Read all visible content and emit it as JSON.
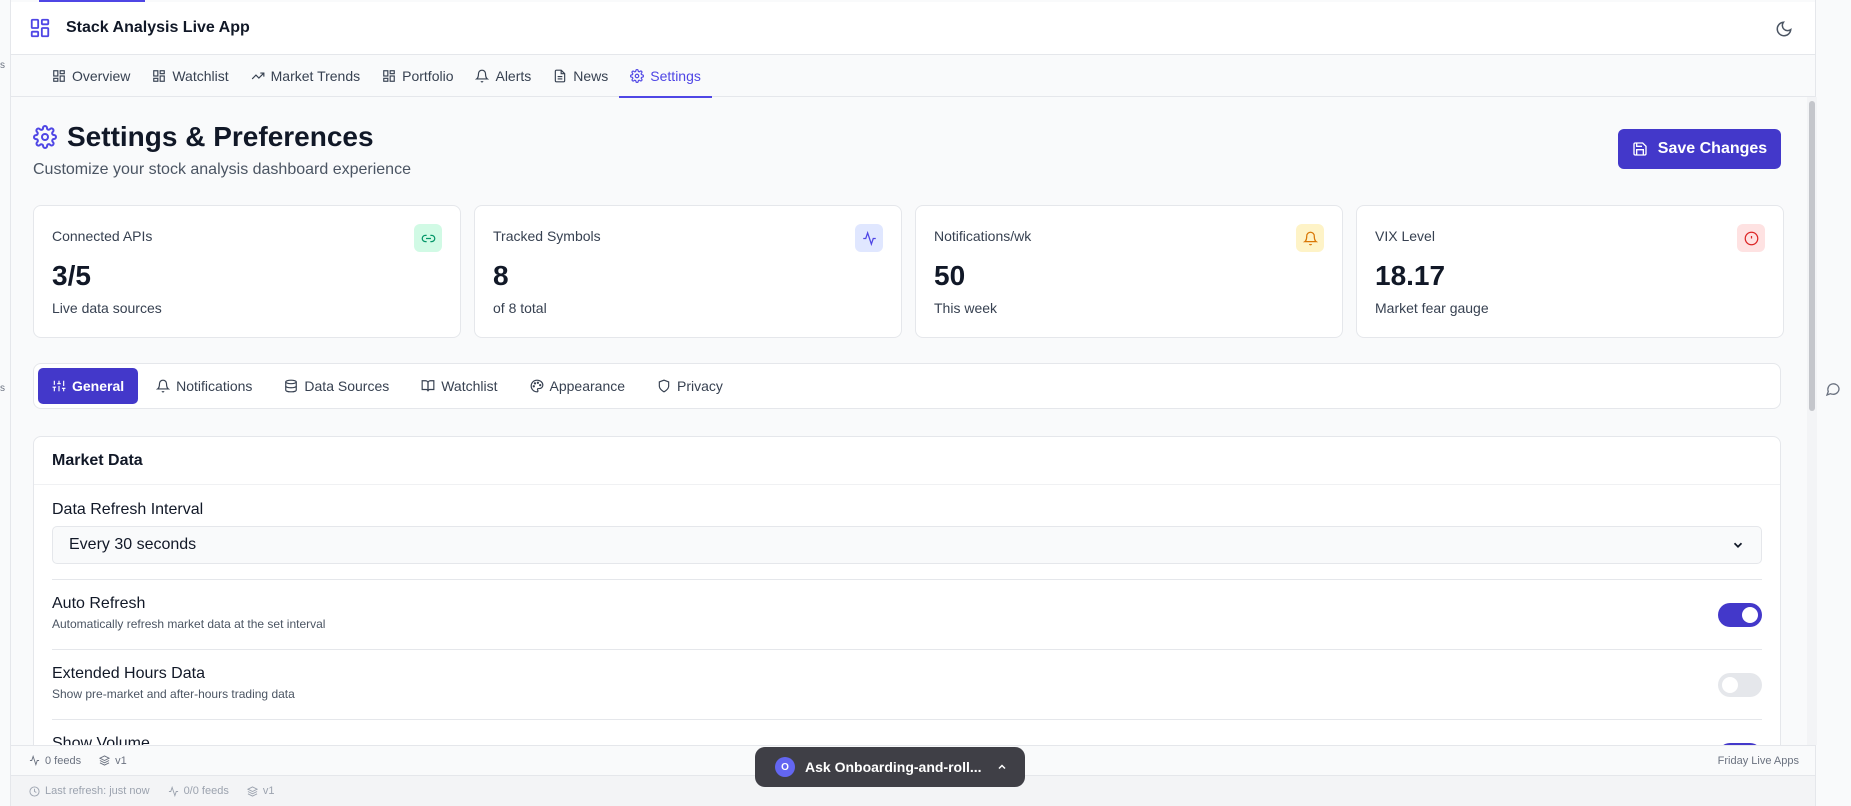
{
  "app": {
    "title": "Stack Analysis Live App"
  },
  "nav": {
    "tabs": [
      {
        "label": "Overview"
      },
      {
        "label": "Watchlist"
      },
      {
        "label": "Market Trends"
      },
      {
        "label": "Portfolio"
      },
      {
        "label": "Alerts"
      },
      {
        "label": "News"
      },
      {
        "label": "Settings"
      }
    ],
    "active": "Settings"
  },
  "page": {
    "title": "Settings & Preferences",
    "subtitle": "Customize your stock analysis dashboard experience",
    "save_label": "Save Changes"
  },
  "stats": [
    {
      "label": "Connected APIs",
      "value": "3/5",
      "note": "Live data sources",
      "icon": "link-icon",
      "icon_color": "#059669",
      "icon_bg": "#d1fae5"
    },
    {
      "label": "Tracked Symbols",
      "value": "8",
      "note": "of 8 total",
      "icon": "activity-icon",
      "icon_color": "#4f46e5",
      "icon_bg": "#e0e7ff"
    },
    {
      "label": "Notifications/wk",
      "value": "50",
      "note": "This week",
      "icon": "bell-icon",
      "icon_color": "#d97706",
      "icon_bg": "#fef3c7"
    },
    {
      "label": "VIX Level",
      "value": "18.17",
      "note": "Market fear gauge",
      "icon": "alert-circle-icon",
      "icon_color": "#dc2626",
      "icon_bg": "#fee2e2"
    }
  ],
  "subtabs": [
    {
      "label": "General"
    },
    {
      "label": "Notifications"
    },
    {
      "label": "Data Sources"
    },
    {
      "label": "Watchlist"
    },
    {
      "label": "Appearance"
    },
    {
      "label": "Privacy"
    }
  ],
  "market_data": {
    "heading": "Market Data",
    "refresh_label": "Data Refresh Interval",
    "refresh_value": "Every 30 seconds",
    "settings": [
      {
        "title": "Auto Refresh",
        "desc": "Automatically refresh market data at the set interval",
        "on": true
      },
      {
        "title": "Extended Hours Data",
        "desc": "Show pre-market and after-hours trading data",
        "on": false
      },
      {
        "title": "Show Volume",
        "desc": "",
        "on": true
      }
    ]
  },
  "footer": {
    "feeds": "0 feeds",
    "version": "v1",
    "last_refresh": "Last refresh: just now",
    "feeds2": "0/0 feeds",
    "version2": "v1",
    "brand": "Friday Live Apps"
  },
  "assistant": {
    "avatar": "O",
    "label": "Ask Onboarding-and-roll..."
  },
  "accent": "#4338ca"
}
